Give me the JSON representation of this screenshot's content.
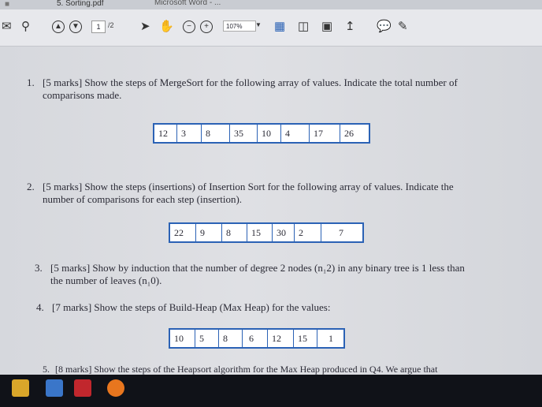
{
  "window": {
    "title": "5. Sorting.pdf",
    "other_title": "Microsoft Word - ..."
  },
  "toolbar": {
    "page_current": "1",
    "page_total": "/2",
    "zoom": "107%"
  },
  "questions": [
    {
      "number": "1.",
      "lines": [
        "[5 marks] Show the steps of MergeSort for the following array of values. Indicate the total number of",
        "comparisons made."
      ],
      "array": [
        "12",
        "3",
        "8",
        "35",
        "10",
        "4",
        "17",
        "26"
      ]
    },
    {
      "number": "2.",
      "lines": [
        "[5 marks] Show the steps (insertions) of Insertion Sort for the following array of values. Indicate the",
        "number of comparisons for each step (insertion)."
      ],
      "array": [
        "22",
        "9",
        "8",
        "15",
        "30",
        "2",
        "7"
      ]
    },
    {
      "number": "3.",
      "lines": [
        "[5 marks] Show by induction that the number of degree 2 nodes (n₁2) in any binary tree is 1 less than",
        "the number of leaves (n₁0)."
      ]
    },
    {
      "number": "4.",
      "lines": [
        "[7 marks] Show the steps of Build-Heap (Max Heap) for the values:"
      ],
      "array": [
        "10",
        "5",
        "8",
        "6",
        "12",
        "15",
        "1"
      ]
    },
    {
      "number": "5.",
      "lines": [
        "[8 marks] Show the steps of the Heapsort algorithm for the Max Heap produced in Q4. We argue that"
      ]
    }
  ]
}
